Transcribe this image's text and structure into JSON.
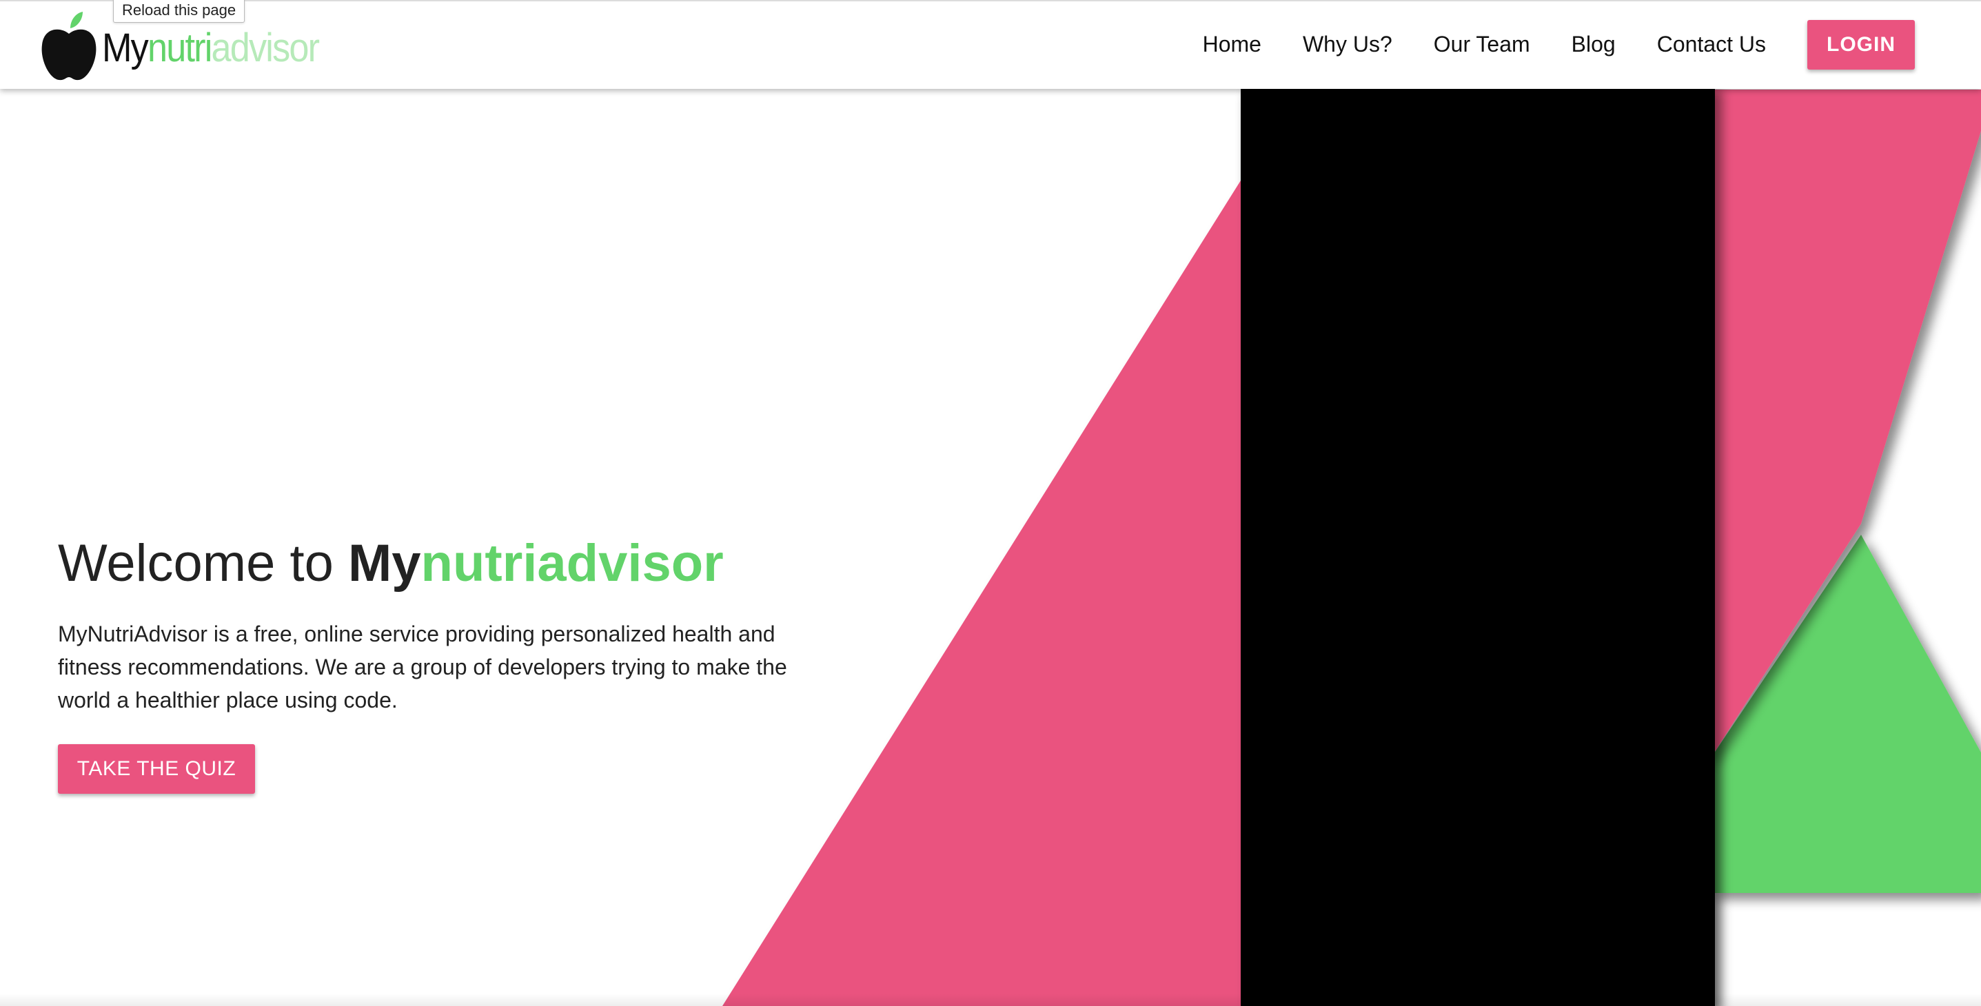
{
  "browser": {
    "tooltip": "Reload this page"
  },
  "header": {
    "logo": {
      "my": "My",
      "nutri": "nutri",
      "advisor": "advisor"
    },
    "nav": [
      "Home",
      "Why Us?",
      "Our Team",
      "Blog",
      "Contact Us"
    ],
    "login_label": "LOGIN"
  },
  "hero": {
    "title_prefix": "Welcome to ",
    "brand_my": "My",
    "brand_rest": "nutriadvisor",
    "description": "MyNutriAdvisor is a free, online service providing personalized health and fitness recommendations. We are a group of developers trying to make the world a healthier place using code.",
    "cta_label": "TAKE THE QUIZ"
  },
  "colors": {
    "accent_pink": "#ea537f",
    "accent_green": "#62d36a",
    "light_green": "#b6eab9",
    "black": "#000000",
    "text": "#222222"
  },
  "icons": {
    "logo": "apple-icon"
  }
}
